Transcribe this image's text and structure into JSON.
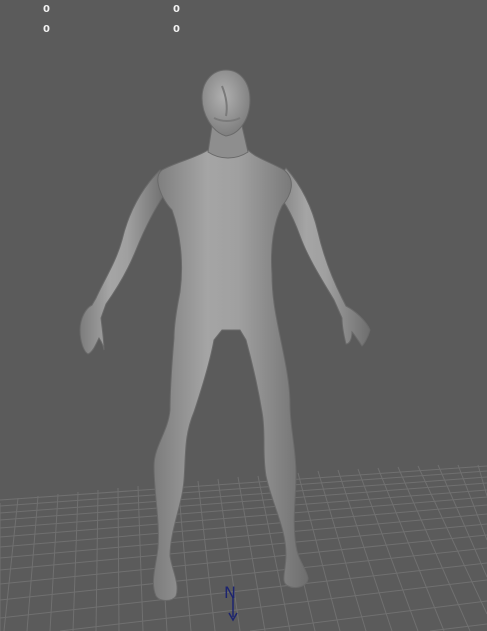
{
  "hud": {
    "row1_left": "0",
    "row1_right": "0",
    "row2_left": "0",
    "row2_right": "0"
  },
  "viewport": {
    "background_color": "#5b5b5b",
    "grid_color": "#6b6b6b",
    "model_color": "#9a9a9a"
  },
  "manipulator": {
    "label": "N",
    "color": "#1c2470"
  }
}
